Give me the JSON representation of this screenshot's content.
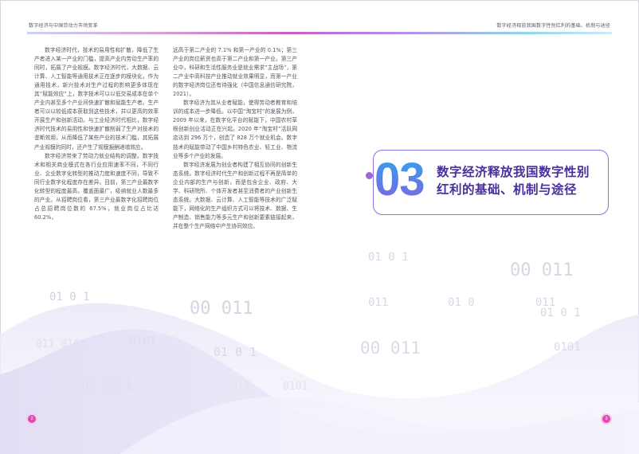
{
  "header": {
    "left_title": "数字经济与中国劳动力市场变革",
    "right_title": "数字经济释放我国数字性别红利的基础、机制与途径",
    "rule_gradient": [
      "#c9d6ef",
      "#c65ec9",
      "#b591e8",
      "#8fd6ea"
    ]
  },
  "body_text": {
    "col1_lines": [
      "数字经济时代，技术的易用性和扩散，",
      "降低了生产者进入某一产业的门槛，提高产业",
      "内劳动生产率的同时，拓展了产业规模。数字",
      "经济时代，大数据、云计算、人工智能等通用",
      "技术正在逐步的模块化，作为通用技术，新兴",
      "技术对生产过程的影响更多体现在其“赋能效",
      "应”上，数字技术可以以低交易成本在单个产",
      "业内甚至多个产业间快速扩散和赋能生产者。",
      "生产者可以以较低成本获取到这些技术，并以",
      "更高的效率开展生产和创新活动。与工业经济",
      "时代相比，数字经济时代技术的易用性和快速",
      "扩散削弱了生产对技术的垄断效用，从而降低了某些",
      "产业的技术门槛，其拓展产业规模的同时，还",
      "产生了规模报酬递增效应。",
      "数字经济带来了劳动力就业结构的调整。",
      "数字技术和相关商业模式在各行业应用速率不",
      "同，不同行业、企业数字化转型的推动力度和",
      "速度不同，导致不同行业数字化程度存在差异。",
      "目前，第三产业最数字化转型的程度最高，覆",
      "盖面最广，吸纳就业人数最多的产业。从招聘",
      "岗位看，第三产业最数字化招聘岗位占总招",
      "聘岗位数的 67.5%，就业岗位占比达 60.2%，"
    ],
    "col2_lines": [
      "远高于第二产业的 7.1% 和第一产业的 0.1%；",
      "第三产业的岗位薪资也高于第二产业和第一产",
      "业。第三产业中，科研和生活性服务业是就业",
      "需求“主战场”，第二产业中高科技产业推动",
      "就业效果明显，而第一产业的数字经济岗位还",
      "有待强化（中国信息通信研究院，2021）。",
      "数字经济为其从业者赋能，使得劳动者教",
      "育和培训的成本进一步降低。以中国“淘宝村”",
      "的发展为例，2009 年以来，在数字化平台的",
      "赋能下，中国农村草根创新创业活动正在兴起。",
      "2020 年“淘宝村”活跃网店达到 296 万个，",
      "创造了 828 万个就业机会。数字技术的赋能带",
      "动了中国乡村特色农业、轻工业、物流业等多",
      "个产业的发展。",
      "数字经济发展为创业者构建了相互协同的",
      "创新生态系统。数字经济时代生产和创新过程",
      "不再是简单的企业内部的生产与创新，而是包",
      "含企业、政府、大学、科研院所、个体开发者",
      "甚至消费者的产业创新生态系统。大数据、",
      "云计算、人工智能等技术的广泛赋能下，网络",
      "化的生产组织方式可以将技术、数据、生产制",
      "造、销售能力等多元生产和创新要素链接起来，",
      "并在整个生产网络中产生协同效应。"
    ]
  },
  "section": {
    "number": "03",
    "title_line1": "数字经济释放我国数字性别",
    "title_line2": "红利的基础、机制与途径",
    "title_color": "#4a2e9e",
    "number_gradient": [
      "#2fa8ee",
      "#8b62dc"
    ],
    "card_border_color": "#8d6fe0"
  },
  "decor": {
    "binary_strings": [
      "01 0 1",
      "00 011",
      "011 0101",
      "01 0 1",
      "00 011",
      "0101",
      "011",
      "0101",
      "01 0 1",
      "00 011",
      "011",
      "01 0",
      "011",
      "01 0 1",
      "00 011",
      "0101"
    ]
  },
  "footer": {
    "page_left": "2",
    "page_right": "3",
    "page_num_color": "#e04bb0"
  }
}
